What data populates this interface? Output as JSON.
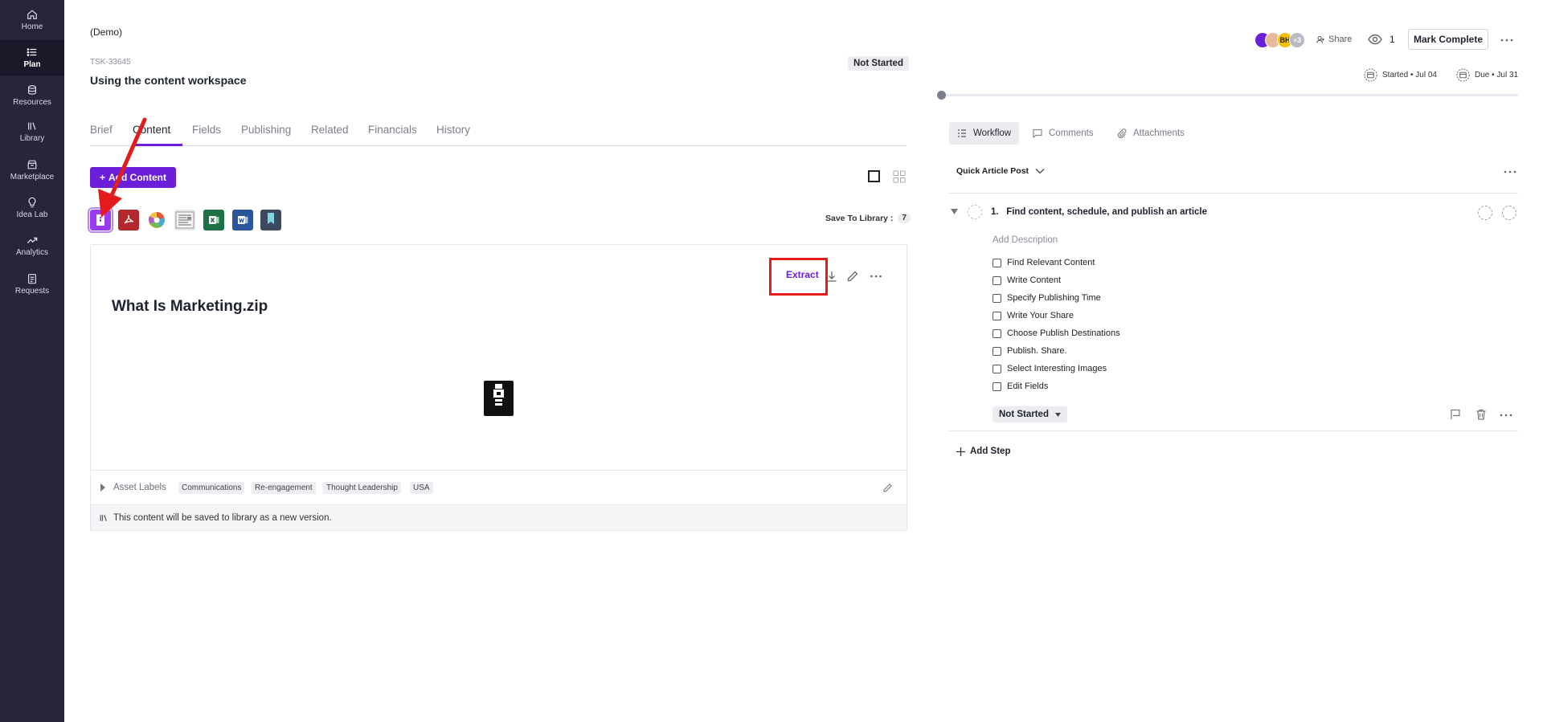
{
  "sidebar": {
    "items": [
      {
        "label": "Home",
        "icon": "home-icon"
      },
      {
        "label": "Plan",
        "icon": "list-icon",
        "active": true
      },
      {
        "label": "Resources",
        "icon": "database-icon"
      },
      {
        "label": "Library",
        "icon": "library-icon"
      },
      {
        "label": "Marketplace",
        "icon": "store-icon"
      },
      {
        "label": "Idea Lab",
        "icon": "lightbulb-icon"
      },
      {
        "label": "Analytics",
        "icon": "trend-icon"
      },
      {
        "label": "Requests",
        "icon": "clipboard-icon"
      }
    ]
  },
  "header": {
    "demo_label": "(Demo)",
    "task_id": "TSK-33645",
    "task_title": "Using the content workspace",
    "status": "Not Started"
  },
  "tabs": [
    "Brief",
    "Content",
    "Fields",
    "Publishing",
    "Related",
    "Financials",
    "History"
  ],
  "active_tab": "Content",
  "toolbar": {
    "add_content_label": "Add Content",
    "save_to_library_label": "Save To Library :",
    "save_to_library_count": "7"
  },
  "assets": [
    {
      "name": "zip-file",
      "color": "#9b3bf0"
    },
    {
      "name": "pdf-file",
      "color": "#b3282d"
    },
    {
      "name": "color-wheel-image",
      "color": "#e0a040"
    },
    {
      "name": "newspaper-image",
      "color": "#888888"
    },
    {
      "name": "excel-file",
      "color": "#1e7145"
    },
    {
      "name": "word-file",
      "color": "#2b579a"
    },
    {
      "name": "bookmark-file",
      "color": "#3b4a5e"
    }
  ],
  "content": {
    "extract_label": "Extract",
    "file_title": "What Is Marketing.zip",
    "labels_title": "Asset Labels",
    "labels": [
      "Communications",
      "Re-engagement",
      "Thought Leadership",
      "USA"
    ],
    "version_note": "This content will be saved to library as a new version."
  },
  "right": {
    "avatars": [
      {
        "initials": "",
        "color": "#6c1fd8"
      },
      {
        "initials": "",
        "color": "#e8b89a"
      },
      {
        "initials": "BH",
        "color": "#f2c200"
      },
      {
        "initials": "+3",
        "color": "#b9bbc4"
      }
    ],
    "share_label": "Share",
    "watch_count": "1",
    "mark_complete_label": "Mark Complete",
    "started_label": "Started • Jul 04",
    "due_label": "Due • Jul 31",
    "tabs": [
      "Workflow",
      "Comments",
      "Attachments"
    ],
    "workflow_name": "Quick Article Post",
    "step": {
      "number": "1.",
      "title": "Find content, schedule, and publish an article",
      "add_description": "Add Description",
      "checklist": [
        "Find Relevant Content",
        "Write Content",
        "Specify Publishing Time",
        "Write Your Share",
        "Choose Publish Destinations",
        "Publish. Share.",
        "Select Interesting Images",
        "Edit Fields"
      ],
      "status": "Not Started"
    },
    "add_step_label": "Add Step"
  },
  "colors": {
    "sidebar_bg": "#262539",
    "accent": "#6c1fd8",
    "annotation_red": "#e51b1b"
  }
}
